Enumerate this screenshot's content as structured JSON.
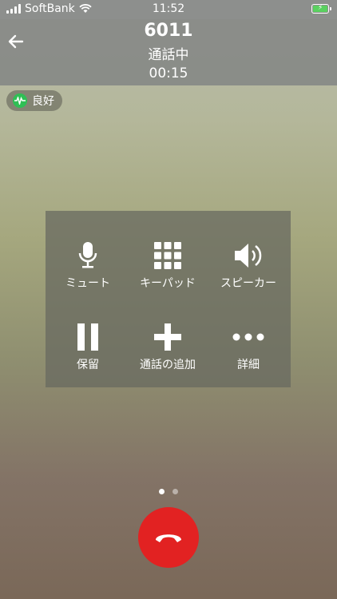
{
  "status_bar": {
    "carrier": "SoftBank",
    "time": "11:52"
  },
  "call": {
    "number": "6011",
    "status": "通話中",
    "timer": "00:15"
  },
  "quality": {
    "label": "良好"
  },
  "controls": [
    {
      "id": "mute",
      "label": "ミュート",
      "icon": "microphone-icon"
    },
    {
      "id": "keypad",
      "label": "キーパッド",
      "icon": "keypad-icon"
    },
    {
      "id": "speaker",
      "label": "スピーカー",
      "icon": "speaker-icon"
    },
    {
      "id": "hold",
      "label": "保留",
      "icon": "pause-icon"
    },
    {
      "id": "add-call",
      "label": "通話の追加",
      "icon": "plus-icon"
    },
    {
      "id": "details",
      "label": "詳細",
      "icon": "more-icon"
    }
  ],
  "page_indicator": {
    "total": 2,
    "active": 1
  },
  "colors": {
    "end_call": "#e22222",
    "quality_ok": "#2fbf55",
    "battery": "#5ad160"
  }
}
